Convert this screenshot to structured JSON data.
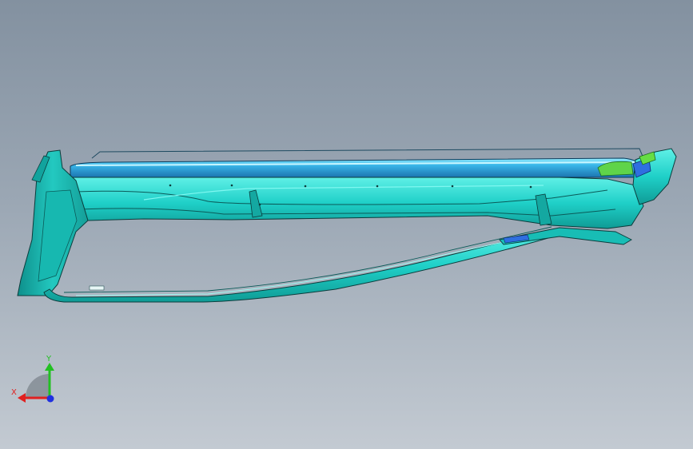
{
  "viewport": {
    "background_top": "#8391a0",
    "background_bottom": "#c3cad2"
  },
  "model": {
    "colors": {
      "body": "#1fd0c8",
      "body_dark": "#0e8f8b",
      "tube": "#3ab8ea",
      "tube_highlight": "#7fe3ff",
      "accent_green": "#5fd44a",
      "accent_blue": "#2f6fe0",
      "edge": "#0b3c3c"
    }
  },
  "triad": {
    "x_label": "X",
    "y_label": "Y",
    "x_color": "#e02020",
    "y_color": "#22c022",
    "z_color": "#2030e0"
  }
}
